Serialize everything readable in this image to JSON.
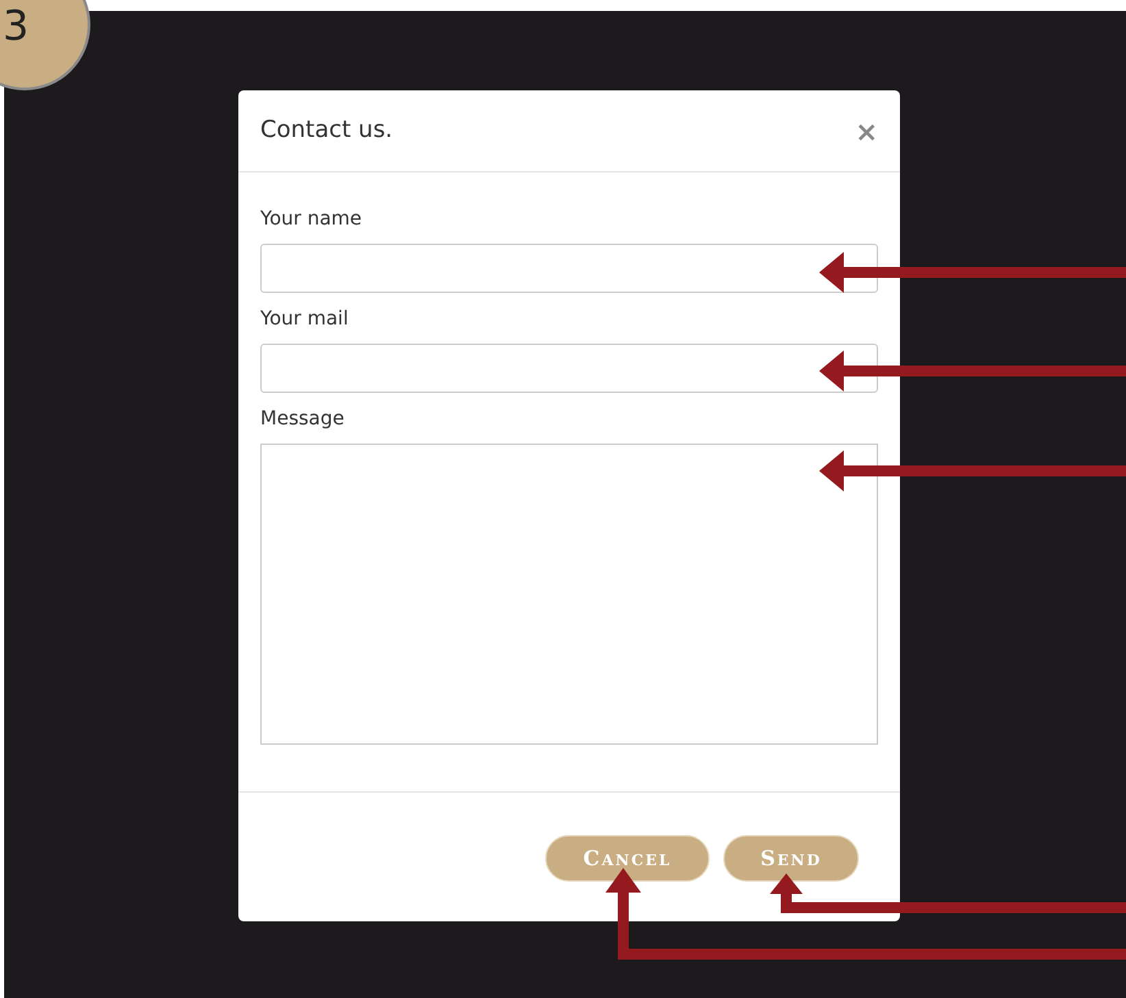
{
  "step_badge": "3",
  "modal": {
    "title": "Contact us.",
    "close": "×",
    "fields": [
      {
        "kind": "input",
        "label": "Your name"
      },
      {
        "kind": "input",
        "label": "Your mail"
      },
      {
        "kind": "textarea",
        "label": "Message"
      }
    ],
    "buttons": [
      "Cancel",
      "Send"
    ]
  }
}
